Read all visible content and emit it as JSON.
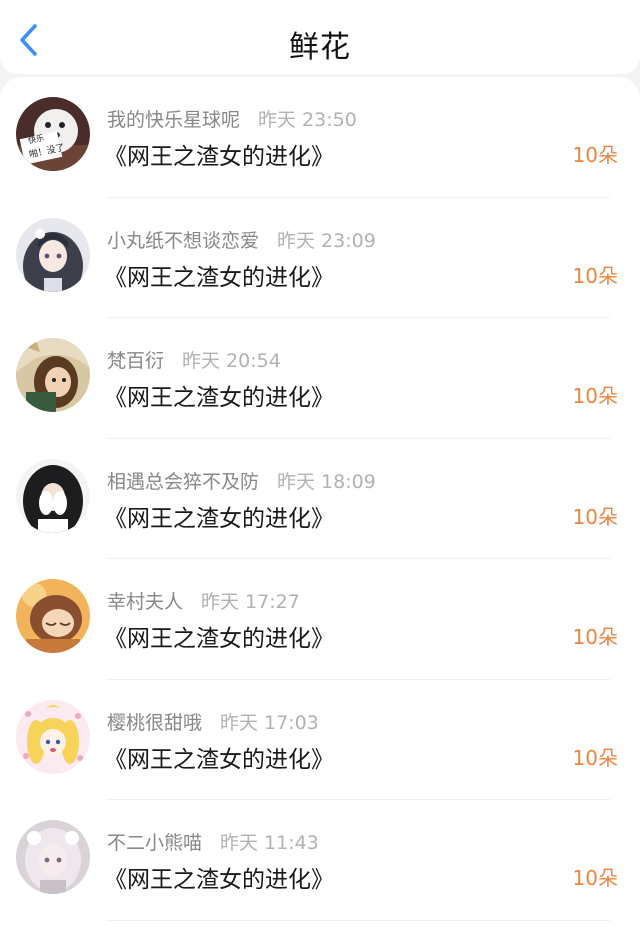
{
  "header": {
    "title": "鲜花",
    "back_icon": "chevron-left-icon",
    "accent": "#3b8ff0"
  },
  "accent_color": "#f0843f",
  "list": [
    {
      "user": "我的快乐星球呢",
      "time": "昨天 23:50",
      "book": "《网王之渣女的进化》",
      "count": "10朵",
      "avatar_text_1": "快乐",
      "avatar_text_2": "啪！没了"
    },
    {
      "user": "小丸纸不想谈恋爱",
      "time": "昨天 23:09",
      "book": "《网王之渣女的进化》",
      "count": "10朵"
    },
    {
      "user": "梵百衍",
      "time": "昨天 20:54",
      "book": "《网王之渣女的进化》",
      "count": "10朵"
    },
    {
      "user": "相遇总会猝不及防",
      "time": "昨天 18:09",
      "book": "《网王之渣女的进化》",
      "count": "10朵"
    },
    {
      "user": "幸村夫人",
      "time": "昨天 17:27",
      "book": "《网王之渣女的进化》",
      "count": "10朵"
    },
    {
      "user": "樱桃很甜哦",
      "time": "昨天 17:03",
      "book": "《网王之渣女的进化》",
      "count": "10朵"
    },
    {
      "user": "不二小熊喵",
      "time": "昨天 11:43",
      "book": "《网王之渣女的进化》",
      "count": "10朵"
    }
  ]
}
